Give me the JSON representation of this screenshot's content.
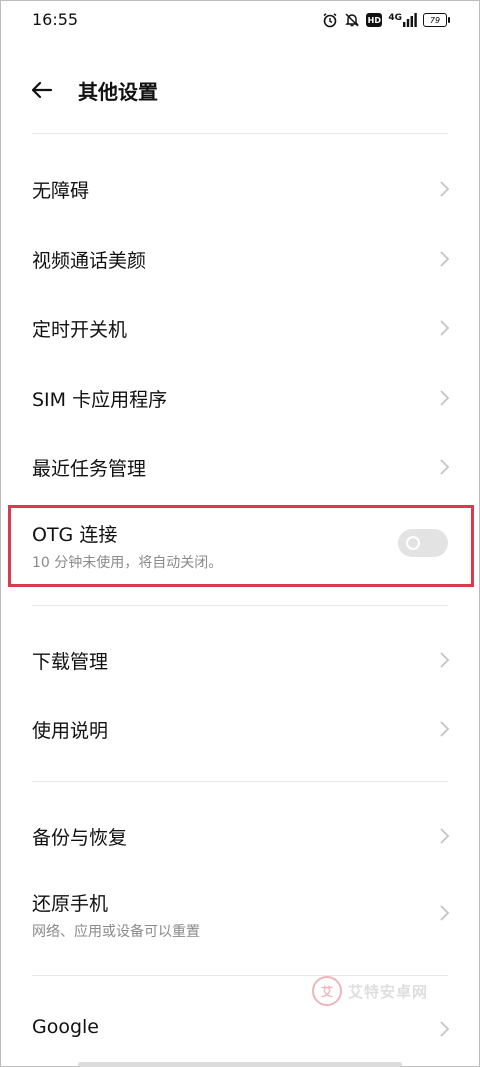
{
  "status_bar": {
    "time": "16:55",
    "icons": [
      "alarm-icon",
      "bell-off-icon",
      "hd-icon",
      "signal-4g-icon",
      "battery-icon"
    ],
    "hd_label": "HD",
    "network_label": "4G",
    "battery_level": "79"
  },
  "header": {
    "back_icon": "arrow-left-icon",
    "title": "其他设置"
  },
  "items": [
    {
      "label": "无障碍"
    },
    {
      "label": "视频通话美颜"
    },
    {
      "label": "定时开关机"
    },
    {
      "label": "SIM 卡应用程序"
    },
    {
      "label": "最近任务管理"
    },
    {
      "label": "OTG 连接",
      "subtitle": "10 分钟未使用，将自动关闭。",
      "toggle_on": false
    },
    {
      "label": "下载管理"
    },
    {
      "label": "使用说明"
    },
    {
      "label": "备份与恢复"
    },
    {
      "label": "还原手机",
      "subtitle": "网络、应用或设备可以重置"
    },
    {
      "label": "Google"
    }
  ],
  "highlight_color": "#d93a4e",
  "watermark": {
    "logo_text": "艾",
    "text": "艾特安卓网"
  }
}
